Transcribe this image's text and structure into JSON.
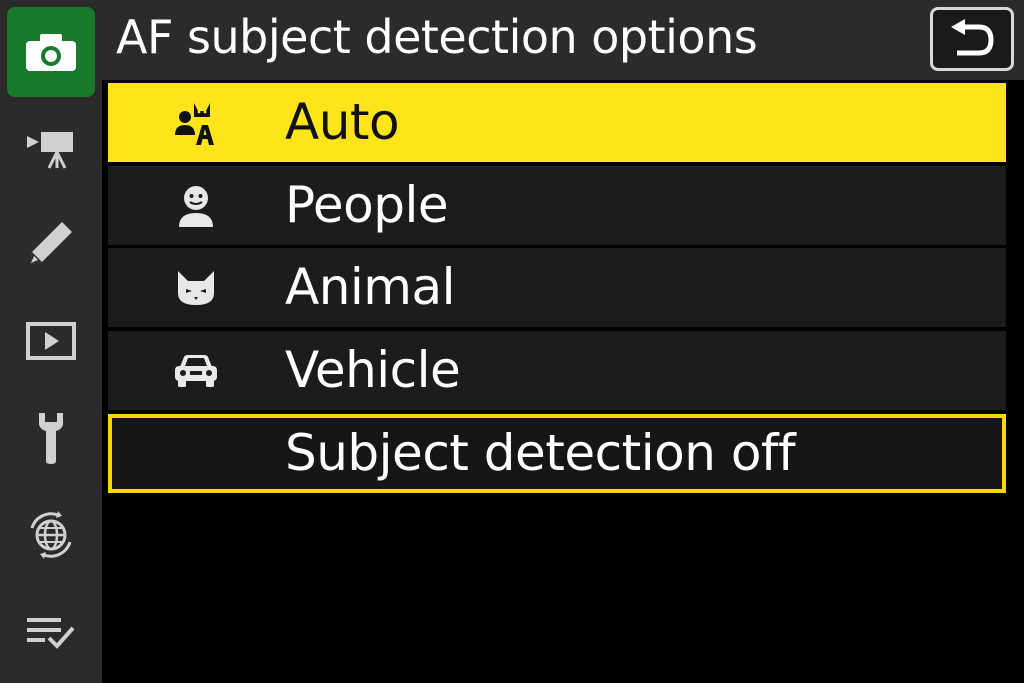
{
  "header": {
    "title": "AF subject detection options",
    "back_icon": "return-arrow-icon"
  },
  "sidebar": {
    "items": [
      {
        "icon": "camera-icon",
        "active": true
      },
      {
        "icon": "movie-camera-icon",
        "active": false
      },
      {
        "icon": "pencil-icon",
        "active": false
      },
      {
        "icon": "playback-icon",
        "active": false
      },
      {
        "icon": "wrench-icon",
        "active": false
      },
      {
        "icon": "network-globe-icon",
        "active": false
      },
      {
        "icon": "my-menu-checklist-icon",
        "active": false
      }
    ]
  },
  "menu": {
    "options": [
      {
        "label": "Auto",
        "icon": "auto-subject-icon",
        "state": "highlighted"
      },
      {
        "label": "People",
        "icon": "person-icon",
        "state": "normal"
      },
      {
        "label": "Animal",
        "icon": "animal-icon",
        "state": "normal"
      },
      {
        "label": "Vehicle",
        "icon": "car-icon",
        "state": "normal"
      },
      {
        "label": "Subject detection off",
        "icon": "",
        "state": "current"
      }
    ]
  },
  "colors": {
    "highlight": "#ffe41a",
    "current_border": "#ffd700",
    "active_tab": "#1a7a2c",
    "panel": "#2b2b2b"
  }
}
